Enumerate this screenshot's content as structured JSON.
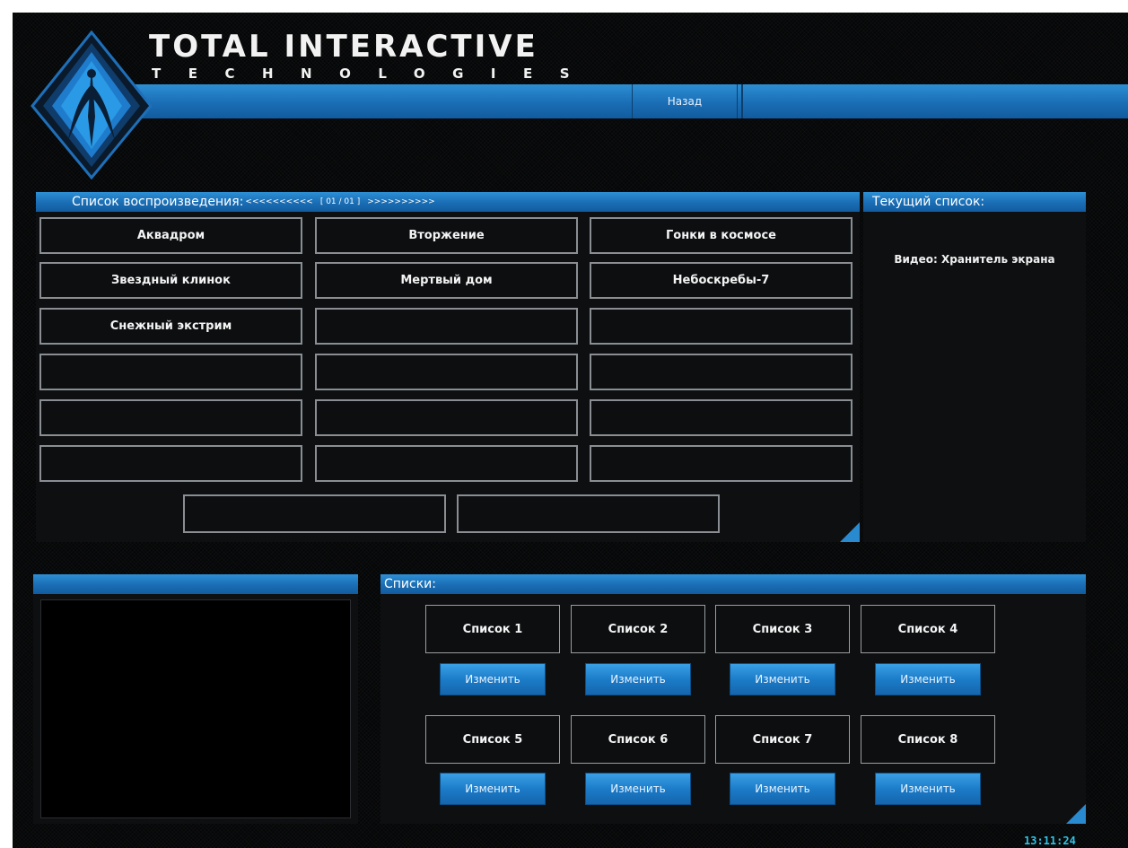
{
  "header": {
    "logo_line1": "TOTAL INTERACTIVE",
    "logo_line2": "TECHNOLOGIES",
    "back_label": "Назад",
    "accent_color": "#1a6db4"
  },
  "playlist": {
    "title": "Список воспроизведения:",
    "prev_arrows": "<<<<<<<<<<",
    "page_indicator": "[ 01 / 01 ]",
    "next_arrows": ">>>>>>>>>>",
    "items": [
      "Аквадром",
      "Вторжение",
      "Гонки в космосе",
      "Звездный клинок",
      "Мертвый дом",
      "Небоскребы-7",
      "Снежный экстрим",
      "",
      "",
      "",
      "",
      "",
      "",
      "",
      "",
      "",
      "",
      ""
    ],
    "nav_buttons": [
      "",
      ""
    ]
  },
  "current": {
    "title": "Текущий список:",
    "value": "Видео: Хранитель экрана"
  },
  "preview": {
    "title": ""
  },
  "lists": {
    "title": "Списки:",
    "items": [
      {
        "label": "Список 1",
        "edit": "Изменить"
      },
      {
        "label": "Список 2",
        "edit": "Изменить"
      },
      {
        "label": "Список 3",
        "edit": "Изменить"
      },
      {
        "label": "Список 4",
        "edit": "Изменить"
      },
      {
        "label": "Список 5",
        "edit": "Изменить"
      },
      {
        "label": "Список 6",
        "edit": "Изменить"
      },
      {
        "label": "Список 7",
        "edit": "Изменить"
      },
      {
        "label": "Список 8",
        "edit": "Изменить"
      }
    ]
  },
  "status": {
    "clock": "13:11:24"
  }
}
